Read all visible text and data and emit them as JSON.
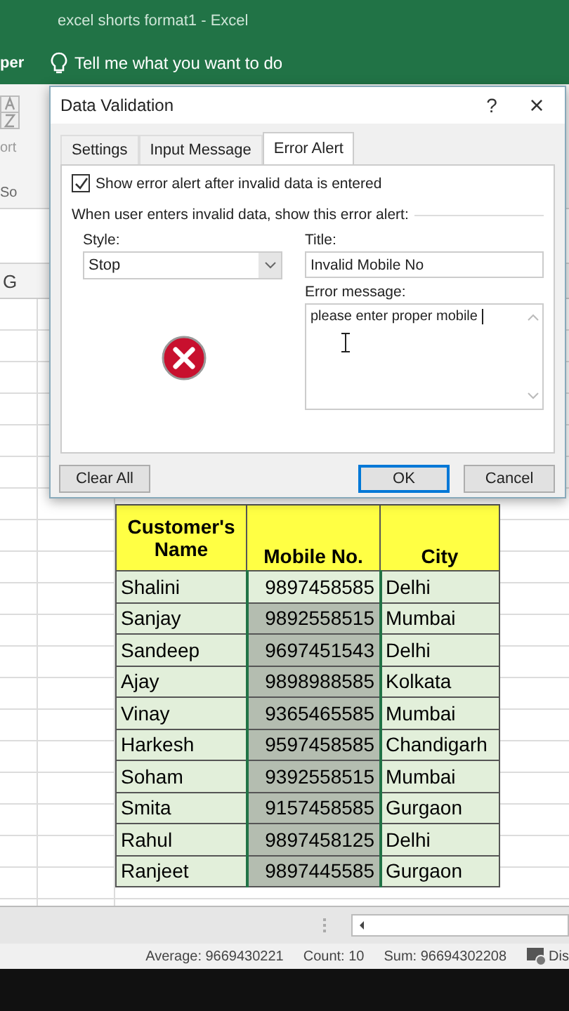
{
  "app": {
    "title": "excel shorts format1  -  Excel",
    "ribbon_tab_fragment": "per",
    "tell_me": "Tell me what you want to do",
    "ribbon_fragments": [
      "ort",
      "So"
    ]
  },
  "sheet": {
    "column_header": "G",
    "table": {
      "columns": [
        "Customer's Name",
        "Mobile No.",
        "City"
      ],
      "rows": [
        {
          "name": "Shalini",
          "mobile": "9897458585",
          "city": "Delhi",
          "active": true
        },
        {
          "name": "Sanjay",
          "mobile": "9892558515",
          "city": "Mumbai",
          "active": false
        },
        {
          "name": "Sandeep",
          "mobile": "9697451543",
          "city": "Delhi",
          "active": false
        },
        {
          "name": "Ajay",
          "mobile": "9898988585",
          "city": "Kolkata",
          "active": false
        },
        {
          "name": "Vinay",
          "mobile": "9365465585",
          "city": "Mumbai",
          "active": false
        },
        {
          "name": "Harkesh",
          "mobile": "9597458585",
          "city": "Chandigarh",
          "active": false
        },
        {
          "name": "Soham",
          "mobile": "9392558515",
          "city": "Mumbai",
          "active": false
        },
        {
          "name": "Smita",
          "mobile": "9157458585",
          "city": "Gurgaon",
          "active": false
        },
        {
          "name": "Rahul",
          "mobile": "9897458125",
          "city": "Delhi",
          "active": false
        },
        {
          "name": "Ranjeet",
          "mobile": "9897445585",
          "city": "Gurgaon",
          "active": false
        }
      ]
    }
  },
  "dialog": {
    "title": "Data Validation",
    "help": "?",
    "close": "×",
    "tabs": [
      {
        "label": "Settings",
        "selected": false
      },
      {
        "label": "Input Message",
        "selected": false
      },
      {
        "label": "Error Alert",
        "selected": true
      }
    ],
    "show_alert": {
      "label": "Show error alert after invalid data is entered",
      "checked": true
    },
    "group_label": "When user enters invalid data, show this error alert:",
    "style": {
      "label": "Style:",
      "value": "Stop"
    },
    "title_field": {
      "label": "Title:",
      "value": "Invalid Mobile No"
    },
    "message_field": {
      "label": "Error message:",
      "value": "please enter proper mobile "
    },
    "buttons": [
      {
        "label": "Clear All",
        "default": false
      },
      {
        "label": "OK",
        "default": true
      },
      {
        "label": "Cancel",
        "default": false
      }
    ]
  },
  "status_bar": [
    "Average: 9669430221",
    "Count: 10",
    "Sum: 96694302208",
    "Dis"
  ]
}
